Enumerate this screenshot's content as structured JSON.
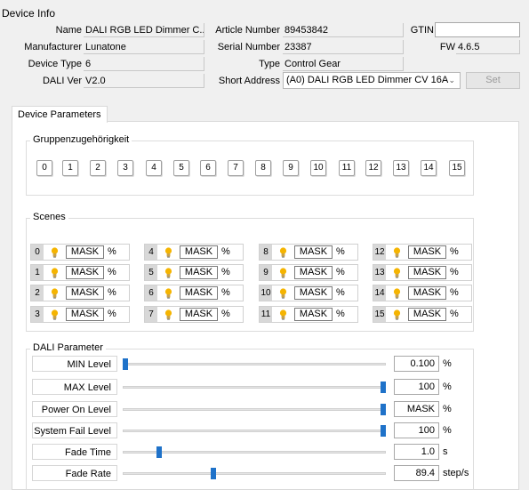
{
  "device_info": {
    "title": "Device Info",
    "name_label": "Name",
    "name_value": "DALI RGB LED Dimmer C...",
    "manufacturer_label": "Manufacturer",
    "manufacturer_value": "Lunatone",
    "device_type_label": "Device Type",
    "device_type_value": "6",
    "dali_ver_label": "DALI Ver",
    "dali_ver_value": "V2.0",
    "article_label": "Article Number",
    "article_value": "89453842",
    "serial_label": "Serial Number",
    "serial_value": "23387",
    "type_label": "Type",
    "type_value": "Control Gear",
    "short_address_label": "Short Address",
    "short_address_value": "(A0) DALI RGB LED Dimmer CV 16A",
    "gtin_label": "GTIN",
    "gtin_value": "",
    "fw_label": "FW",
    "fw_value": "4.6.5",
    "set_label": "Set"
  },
  "tabs": {
    "device_parameters": "Device Parameters"
  },
  "groups": {
    "title": "Gruppenzugehörigkeit",
    "items": [
      "0",
      "1",
      "2",
      "3",
      "4",
      "5",
      "6",
      "7",
      "8",
      "9",
      "10",
      "11",
      "12",
      "13",
      "14",
      "15"
    ]
  },
  "scenes": {
    "title": "Scenes",
    "mask": "MASK",
    "unit": "%",
    "items": [
      "0",
      "1",
      "2",
      "3",
      "4",
      "5",
      "6",
      "7",
      "8",
      "9",
      "10",
      "11",
      "12",
      "13",
      "14",
      "15"
    ]
  },
  "dali": {
    "title": "DALI Parameter",
    "params": [
      {
        "label": "MIN Level",
        "value": "0.100",
        "unit": "%",
        "level": 0.0
      },
      {
        "label": "MAX Level",
        "value": "100",
        "unit": "%",
        "level": 1.0
      },
      {
        "label": "Power On Level",
        "value": "MASK",
        "unit": "%",
        "level": 1.0
      },
      {
        "label": "System Fail Level",
        "value": "100",
        "unit": "%",
        "level": 1.0
      },
      {
        "label": "Fade Time",
        "value": "1.0",
        "unit": "s",
        "level": 0.13
      },
      {
        "label": "Fade Rate",
        "value": "89.4",
        "unit": "step/s",
        "level": 0.34
      }
    ]
  },
  "colors": {
    "slider_thumb": "#1f72c9",
    "bulb": "#f5b400"
  }
}
